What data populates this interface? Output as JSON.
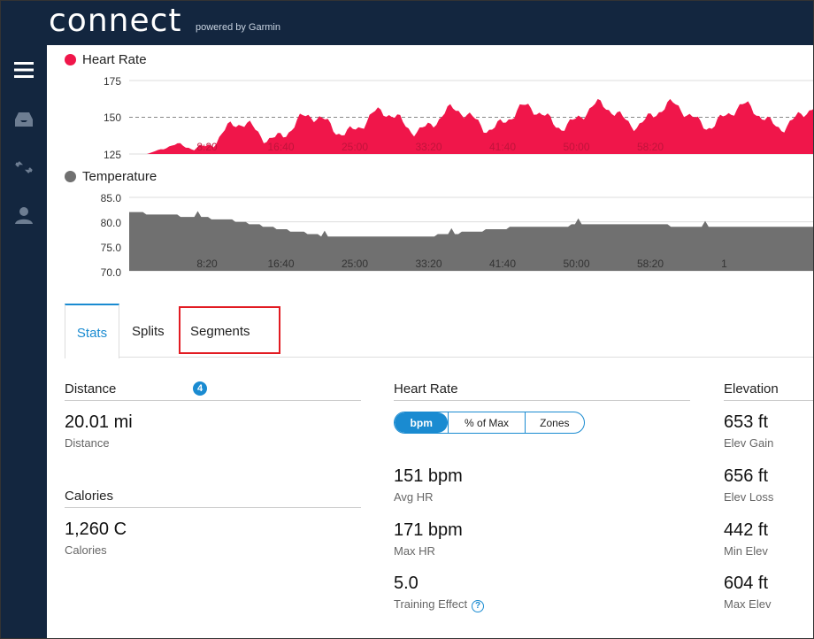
{
  "brand": {
    "logo": "connect",
    "powered": "powered by Garmin"
  },
  "colors": {
    "topbar": "#13263f",
    "heart": "#f0164a",
    "temp": "#707070",
    "accent": "#1a8bd1",
    "highlight": "#e21b22"
  },
  "sidebar": {
    "icons": [
      "menu-icon",
      "inbox-icon",
      "expand-icon",
      "user-icon"
    ]
  },
  "heart_chart": {
    "legend": "Heart Rate",
    "yticks": [
      "175",
      "150",
      "125"
    ],
    "xticks": [
      "8:20",
      "16:40",
      "25:00",
      "33:20",
      "41:40",
      "50:00",
      "58:20"
    ]
  },
  "temp_chart": {
    "legend": "Temperature",
    "yticks": [
      "85.0",
      "80.0",
      "75.0",
      "70.0"
    ],
    "xticks": [
      "8:20",
      "16:40",
      "25:00",
      "33:20",
      "41:40",
      "50:00",
      "58:20",
      "1"
    ]
  },
  "chart_data": [
    {
      "type": "area",
      "title": "Heart Rate",
      "ylim": [
        125,
        175
      ],
      "reference_line": 150,
      "x": [
        "0:00",
        "8:20",
        "16:40",
        "25:00",
        "33:20",
        "41:40",
        "50:00",
        "58:20"
      ],
      "values": [
        125,
        140,
        146,
        148,
        150,
        152,
        151,
        150
      ]
    },
    {
      "type": "area",
      "title": "Temperature",
      "ylim": [
        70,
        85
      ],
      "x": [
        "0:00",
        "8:20",
        "16:40",
        "25:00",
        "33:20",
        "41:40",
        "50:00",
        "58:20"
      ],
      "values": [
        82,
        80.5,
        77,
        77,
        79,
        79.5,
        79,
        79
      ]
    }
  ],
  "tabs": {
    "stats": "Stats",
    "splits": "Splits",
    "segments": "Segments",
    "segments_count": "4"
  },
  "distance": {
    "title": "Distance",
    "value": "20.01 mi",
    "label": "Distance"
  },
  "calories": {
    "title": "Calories",
    "value": "1,260 C",
    "label": "Calories"
  },
  "heart_rate": {
    "title": "Heart Rate",
    "toggle": {
      "bpm": "bpm",
      "max": "% of Max",
      "zones": "Zones"
    },
    "avg": {
      "value": "151 bpm",
      "label": "Avg HR"
    },
    "max": {
      "value": "171 bpm",
      "label": "Max HR"
    },
    "te": {
      "value": "5.0",
      "label": "Training Effect"
    }
  },
  "elevation": {
    "title": "Elevation",
    "gain": {
      "value": "653 ft",
      "label": "Elev Gain"
    },
    "loss": {
      "value": "656 ft",
      "label": "Elev Loss"
    },
    "min": {
      "value": "442 ft",
      "label": "Min Elev"
    },
    "max": {
      "value": "604 ft",
      "label": "Max Elev"
    }
  }
}
